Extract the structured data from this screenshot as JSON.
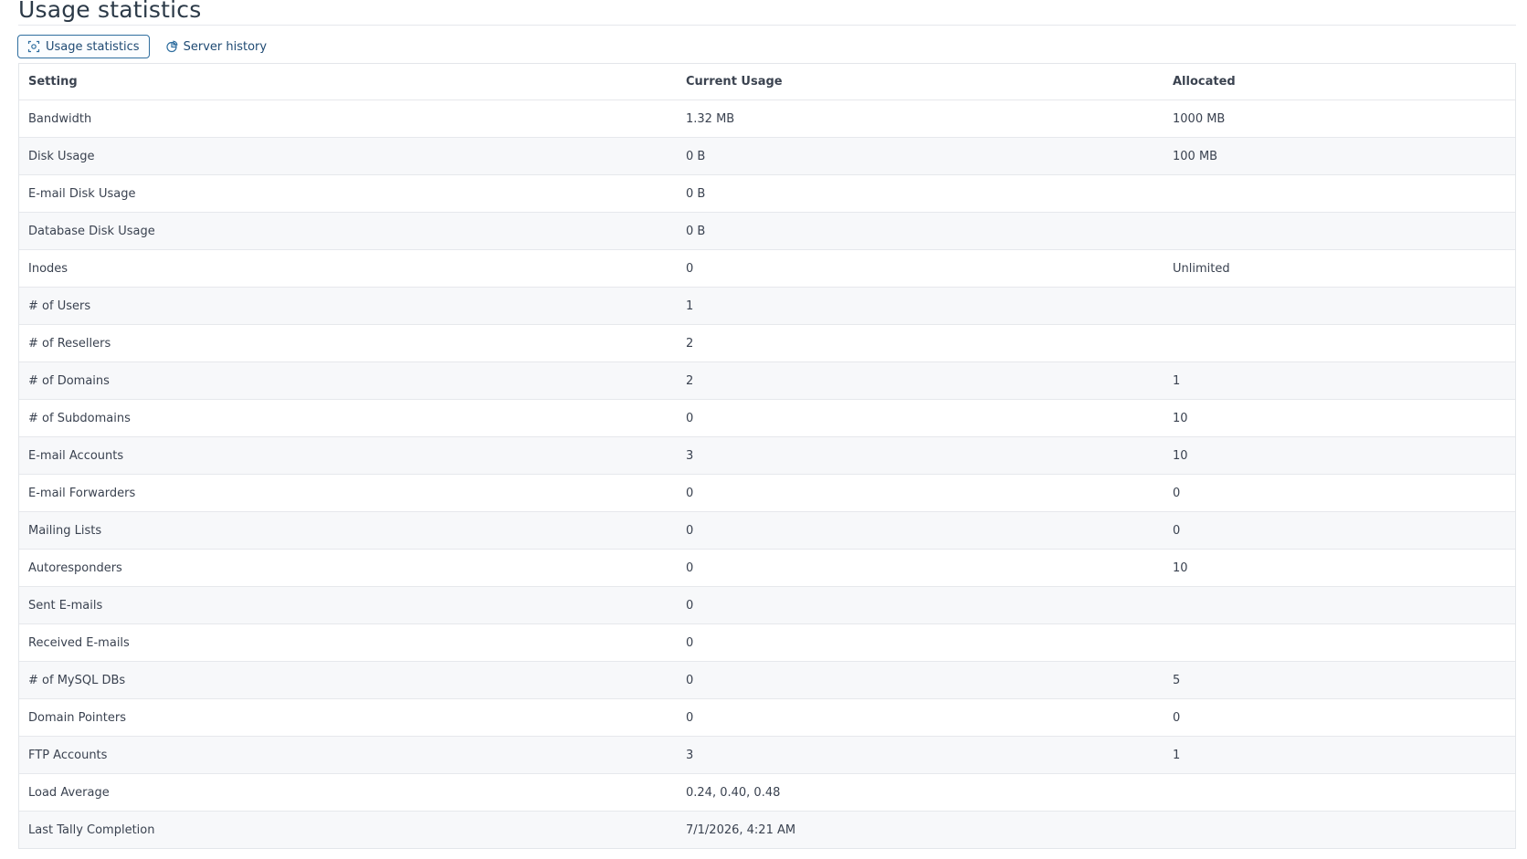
{
  "page": {
    "title": "Usage statistics"
  },
  "tabs": [
    {
      "label": "Usage statistics",
      "icon": "usage-stats-icon",
      "active": true
    },
    {
      "label": "Server history",
      "icon": "history-chart-icon",
      "active": false
    }
  ],
  "table": {
    "headers": [
      "Setting",
      "Current Usage",
      "Allocated"
    ],
    "rows": [
      [
        "Bandwidth",
        "1.32 MB",
        "1000 MB"
      ],
      [
        "Disk Usage",
        "0 B",
        "100 MB"
      ],
      [
        "E-mail Disk Usage",
        "0 B",
        ""
      ],
      [
        "Database Disk Usage",
        "0 B",
        ""
      ],
      [
        "Inodes",
        "0",
        "Unlimited"
      ],
      [
        "# of Users",
        "1",
        ""
      ],
      [
        "# of Resellers",
        "2",
        ""
      ],
      [
        "# of Domains",
        "2",
        "1"
      ],
      [
        "# of Subdomains",
        "0",
        "10"
      ],
      [
        "E-mail Accounts",
        "3",
        "10"
      ],
      [
        "E-mail Forwarders",
        "0",
        "0"
      ],
      [
        "Mailing Lists",
        "0",
        "0"
      ],
      [
        "Autoresponders",
        "0",
        "10"
      ],
      [
        "Sent E-mails",
        "0",
        ""
      ],
      [
        "Received E-mails",
        "0",
        ""
      ],
      [
        "# of MySQL DBs",
        "0",
        "5"
      ],
      [
        "Domain Pointers",
        "0",
        "0"
      ],
      [
        "FTP Accounts",
        "3",
        "1"
      ],
      [
        "Load Average",
        "0.24, 0.40, 0.48",
        ""
      ],
      [
        "Last Tally Completion",
        "7/1/2026, 4:21 AM",
        ""
      ]
    ]
  },
  "colors": {
    "accent": "#2f6e9f",
    "tab_text": "#1f4a73",
    "row_alt": "#f7f8fa",
    "border": "#e6e8ec"
  }
}
